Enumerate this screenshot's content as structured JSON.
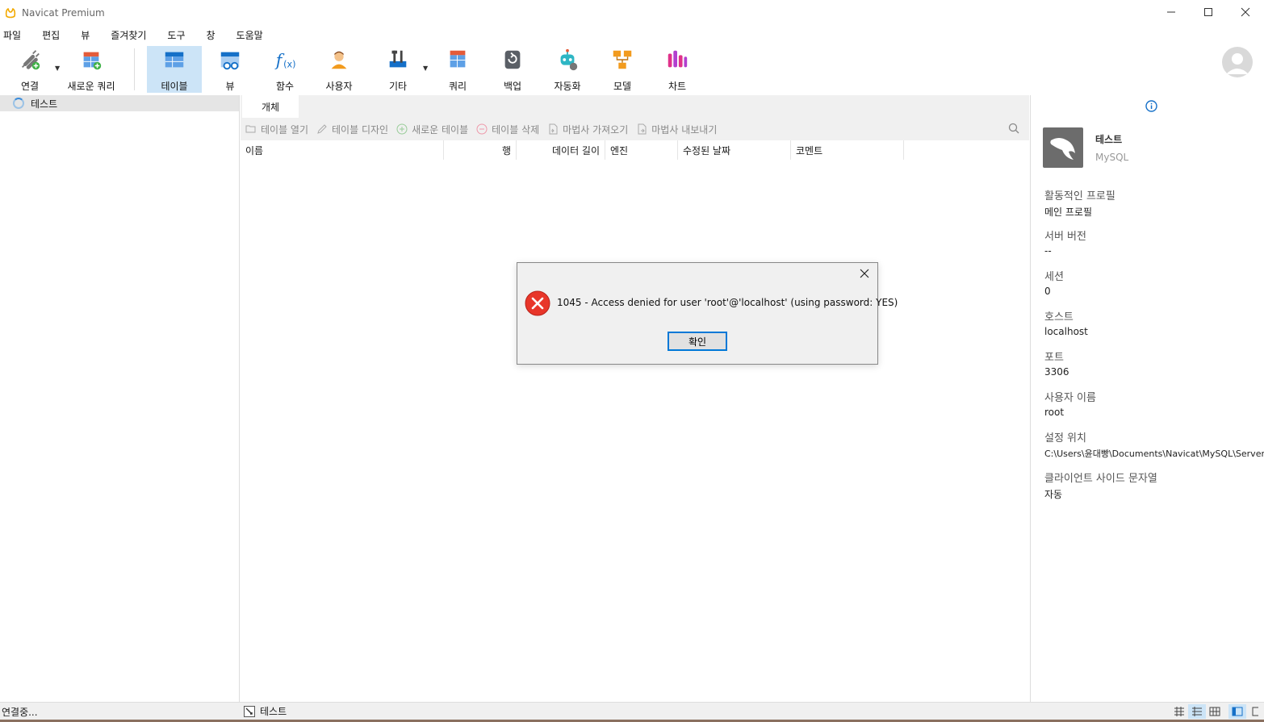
{
  "window": {
    "title": "Navicat Premium",
    "minimize": "—",
    "maximize": "☐",
    "close": "✕"
  },
  "menu": [
    "파일",
    "편집",
    "뷰",
    "즐겨찾기",
    "도구",
    "창",
    "도움말"
  ],
  "toolbar": {
    "connect": "연결",
    "new_query": "새로운 쿼리",
    "table": "테이블",
    "view": "뷰",
    "function": "함수",
    "user": "사용자",
    "other": "기타",
    "query": "쿼리",
    "backup": "백업",
    "automation": "자동화",
    "model": "모델",
    "chart": "차트"
  },
  "navigator": {
    "connection_name": "테스트"
  },
  "tabs": {
    "objects": "개체"
  },
  "object_toolbar": {
    "open_table": "테이블 열기",
    "design_table": "테이블 디자인",
    "new_table": "새로운 테이블",
    "delete_table": "테이블 삭제",
    "import_wizard": "마법사 가져오기",
    "export_wizard": "마법사 내보내기"
  },
  "grid_columns": {
    "name": "이름",
    "rows": "행",
    "data_length": "데이터 길이",
    "engine": "엔진",
    "modified_date": "수정된 날짜",
    "comment": "코멘트"
  },
  "info_panel": {
    "connection_name": "테스트",
    "connection_type": "MySQL",
    "props": [
      {
        "key": "활동적인 프로필",
        "value": "메인 프로필"
      },
      {
        "key": "서버 버전",
        "value": "--"
      },
      {
        "key": "세션",
        "value": "0"
      },
      {
        "key": "호스트",
        "value": "localhost"
      },
      {
        "key": "포트",
        "value": "3306"
      },
      {
        "key": "사용자 이름",
        "value": "root"
      },
      {
        "key": "설정 위치",
        "value": "C:\\Users\\윤대빵\\Documents\\Navicat\\MySQL\\Servers"
      },
      {
        "key": "클라이언트 사이드 문자열",
        "value": "자동"
      }
    ]
  },
  "status": {
    "text": "연결중...",
    "connection": "테스트"
  },
  "dialog": {
    "message": "1045 - Access denied for user 'root'@'localhost' (using password: YES)",
    "ok": "확인"
  },
  "colors": {
    "accent": "#0078d7",
    "active_tool": "#cce4f7",
    "error": "#e8362a"
  }
}
